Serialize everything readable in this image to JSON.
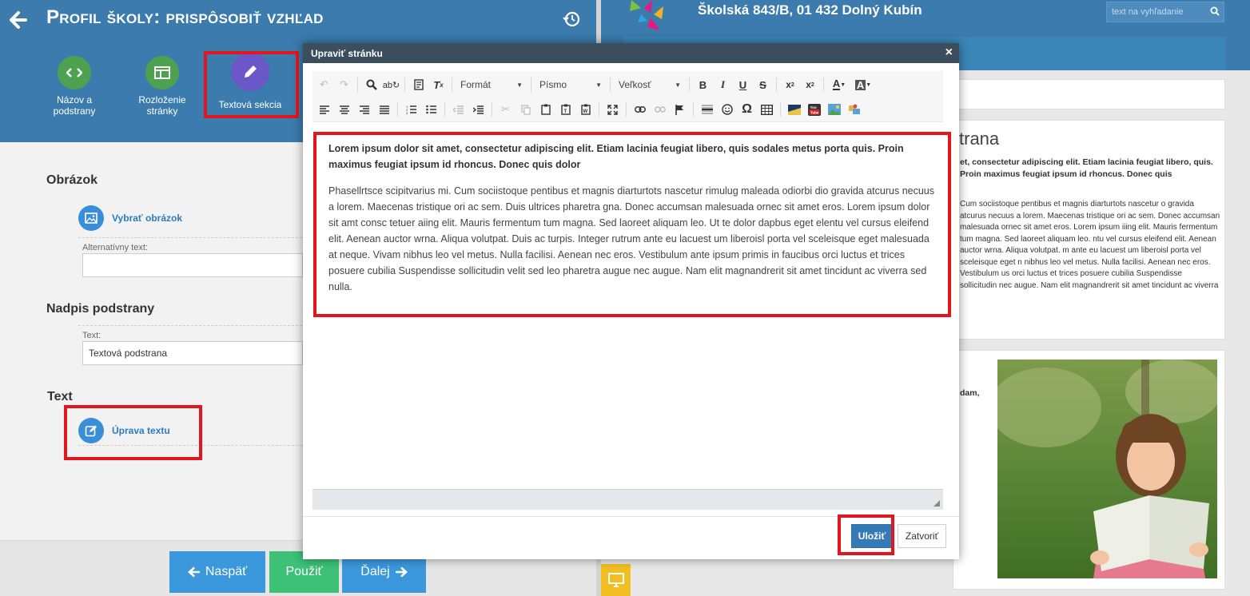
{
  "header": {
    "title": "Profil školy: prispôsobiť vzhľad"
  },
  "tools": [
    {
      "label": "Názov a podstrany",
      "icon": "code-icon"
    },
    {
      "label": "Rozloženie stránky",
      "icon": "layout-icon"
    },
    {
      "label": "Textová sekcia",
      "icon": "pencil-icon"
    }
  ],
  "sections": {
    "image": {
      "title": "Obrázok",
      "action": "Vybrať obrázok",
      "alt_label": "Alternatívny text:",
      "alt_value": ""
    },
    "subtitle": {
      "title": "Nadpis podstrany",
      "text_label": "Text:",
      "text_value": "Textová podstrana"
    },
    "text": {
      "title": "Text",
      "action": "Úprava textu"
    }
  },
  "nav_buttons": {
    "back": "Naspäť",
    "apply": "Použiť",
    "next": "Ďalej"
  },
  "site": {
    "address": "Školská 843/B, 01 432 Dolný Kubín",
    "search_placeholder": "text na vyhľadanie",
    "preview_heading_fragment": "trana",
    "preview_bold": "et, consectetur adipiscing elit. Etiam lacinia feugiat libero, quis. Proin maximus feugiat ipsum id rhoncus. Donec quis",
    "preview_body": "Cum sociistoque pentibus et magnis diarturtots nascetur o gravida atcurus necuus a lorem. Maecenas tristique ori ac sem. Donec accumsan malesuada ornec sit amet eros. Lorem ipsum iiing elit. Mauris fermentum tum magna. Sed laoreet aliquam leo. ntu vel cursus eleifend elit. Aenean auctor wrna. Aliqua volutpat. m ante eu lacuest um liberoisl porta vel sceleisque eget n nibhus leo vel metus. Nulla facilisi. Aenean nec eros. Vestibulum us orci luctus et trices posuere cubilia Suspendisse sollicitudin nec augue. Nam elit magnandrerit sit amet tincidunt ac viverra",
    "card2_fragment": "dam,"
  },
  "modal": {
    "title": "Upraviť stránku",
    "toolbar": {
      "format": "Formát",
      "font": "Písmo",
      "size": "Veľkosť"
    },
    "content_bold": "Lorem ipsum dolor sit amet, consectetur adipiscing elit. Etiam lacinia feugiat libero, quis sodales metus porta quis. Proin maximus feugiat ipsum id rhoncus. Donec quis dolor",
    "content_body": "Phasellrtsce scipitvarius mi. Cum sociistoque pentibus et magnis diarturtots nascetur rimulug maleada odiorbi dio gravida atcurus necuus a lorem. Maecenas tristique ori ac sem. Duis ultrices pharetra gna. Donec accumsan malesuada ornec sit amet eros. Lorem ipsum dolor sit amt consc tetuer aiing elit. Mauris fermentum tum magna. Sed laoreet aliquam leo. Ut te dolor dapbus eget elentu vel cursus eleifend elit. Aenean auctor wrna. Aliqua volutpat. Duis ac turpis. Integer rutrum ante eu lacuest um liberoisl porta vel sceleisque eget malesuada at neque. Vivam nibhus leo vel metus. Nulla facilisi. Aenean nec eros. Vestibulum ante ipsum primis in faucibus orci luctus et trices posuere cubilia Suspendisse sollicitudin velit sed leo pharetra augue nec augue. Nam elit magnandrerit sit amet tincidunt ac viverra sed nulla.",
    "save": "Uložiť",
    "close": "Zatvoriť"
  },
  "colors": {
    "header_blue": "#3b7bad",
    "highlight_red": "#e3161e",
    "save_blue": "#337ab7",
    "apply_green": "#3cc177"
  }
}
